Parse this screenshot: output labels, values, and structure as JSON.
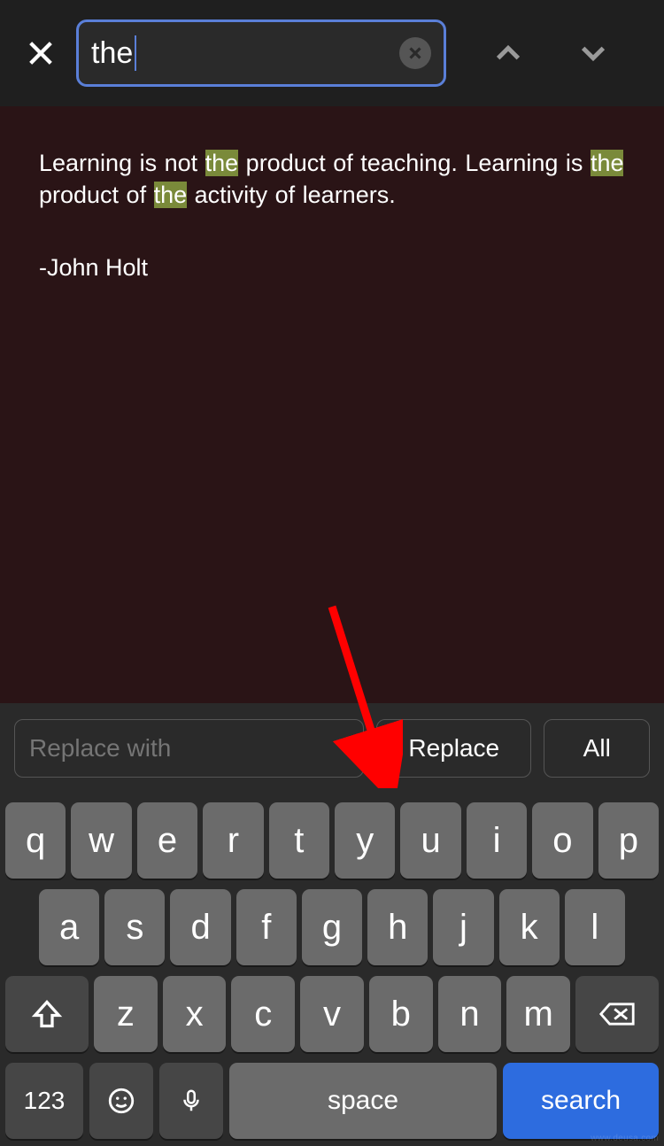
{
  "search": {
    "value": "the",
    "clear_icon": "clear"
  },
  "doc": {
    "segments": [
      {
        "t": "Learning is not ",
        "hl": false
      },
      {
        "t": "the",
        "hl": true
      },
      {
        "t": " product of teaching. Learning is ",
        "hl": false
      },
      {
        "t": "the",
        "hl": true
      },
      {
        "t": " product of ",
        "hl": false
      },
      {
        "t": "the",
        "hl": true
      },
      {
        "t": " activity of learners.",
        "hl": false
      }
    ],
    "author": "-John Holt"
  },
  "replace": {
    "placeholder": "Replace with",
    "replace_label": "Replace",
    "all_label": "All"
  },
  "keyboard": {
    "row1": [
      "q",
      "w",
      "e",
      "r",
      "t",
      "y",
      "u",
      "i",
      "o",
      "p"
    ],
    "row2": [
      "a",
      "s",
      "d",
      "f",
      "g",
      "h",
      "j",
      "k",
      "l"
    ],
    "row3": [
      "z",
      "x",
      "c",
      "v",
      "b",
      "n",
      "m"
    ],
    "sym": "123",
    "space": "space",
    "search": "search"
  },
  "watermark": "www.deusa.com"
}
